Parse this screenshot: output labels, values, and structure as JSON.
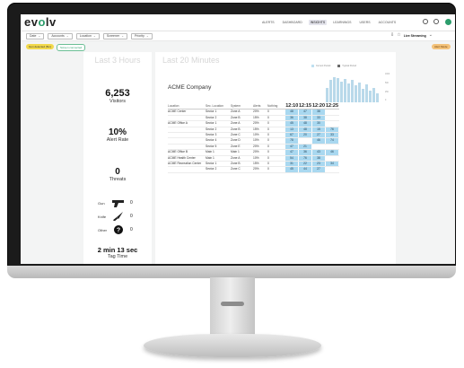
{
  "app": {
    "logo_prefix": "ev",
    "logo_o": "o",
    "logo_suffix": "lv"
  },
  "nav": [
    "ALERTS",
    "DASHBOARD",
    "INSIGHTS",
    "LEARNINGS",
    "USERS",
    "ACCOUNTS"
  ],
  "nav_active_index": 2,
  "header_icons": [
    "help-icon",
    "settings-icon",
    "profile-icon"
  ],
  "filters": [
    "Date",
    "Accounts",
    "Location",
    "Screener",
    "Priority"
  ],
  "live": {
    "label": "Live Streaming",
    "icons": [
      "share-icon",
      "star-icon",
      "more-icon"
    ]
  },
  "chips": {
    "yellow": "Gun detected (5m)",
    "outline": "Screen connected",
    "orange": "Alert Mode"
  },
  "left_panel": {
    "title": "Last 3 Hours",
    "visitors_value": "6,253",
    "visitors_label": "Visitors",
    "alert_rate_value": "10%",
    "alert_rate_label": "Alert Rate",
    "threats_value": "0",
    "threats_label": "Threats",
    "weapons": [
      {
        "label": "Gun",
        "icon": "gun-icon",
        "count": "0"
      },
      {
        "label": "Knife",
        "icon": "knife-icon",
        "count": "0"
      },
      {
        "label": "Other",
        "icon": "other-icon",
        "count": "0"
      }
    ],
    "tag_time_value": "2 min 13 sec",
    "tag_time_label": "Tag Time"
  },
  "right_panel": {
    "title": "Last 20 Minutes",
    "company": "ACME Company",
    "legend": [
      "Current Period",
      "Typical Period"
    ],
    "legend_colors": [
      "#bfe0f0",
      "#6a6a6a"
    ],
    "y_ticks": [
      "1000",
      "500",
      "250",
      "0"
    ],
    "columns": [
      "Location",
      "Sec. Location",
      "System",
      "Alerts",
      "Nothing"
    ],
    "times": [
      "12:10",
      "12:15",
      "12:20",
      "12:25"
    ],
    "rows": [
      {
        "location": "ACME Center",
        "sec": "Sector 1",
        "system": "Zone A",
        "alerts": "20%",
        "nothing": "0",
        "vals": [
          "48",
          "47",
          "38",
          ""
        ]
      },
      {
        "location": "",
        "sec": "Sector 2",
        "system": "Zone B",
        "alerts": "15%",
        "nothing": "0",
        "vals": [
          "36",
          "38",
          "33",
          ""
        ]
      },
      {
        "location": "ACME Office A",
        "sec": "Sector 1",
        "system": "Zone A",
        "alerts": "20%",
        "nothing": "0",
        "vals": [
          "45",
          "48",
          "30",
          ""
        ]
      },
      {
        "location": "",
        "sec": "Sector 2",
        "system": "Zone B",
        "alerts": "15%",
        "nothing": "0",
        "vals": [
          "13",
          "48",
          "15",
          "76"
        ]
      },
      {
        "location": "",
        "sec": "Sector 3",
        "system": "Zone C",
        "alerts": "10%",
        "nothing": "0",
        "vals": [
          "67",
          "20",
          "27",
          "33"
        ]
      },
      {
        "location": "",
        "sec": "Sector 4",
        "system": "Zone D",
        "alerts": "10%",
        "nothing": "0",
        "vals": [
          "78",
          "",
          "46",
          "74"
        ]
      },
      {
        "location": "",
        "sec": "Sector 5",
        "system": "Zone E",
        "alerts": "20%",
        "nothing": "0",
        "vals": [
          "47",
          "21",
          "",
          ""
        ]
      },
      {
        "location": "ACME Office B",
        "sec": "Main 1",
        "system": "Main 1",
        "alerts": "20%",
        "nothing": "0",
        "vals": [
          "47",
          "36",
          "43",
          "46"
        ]
      },
      {
        "location": "ACME Health Center",
        "sec": "Main 1",
        "system": "Zone A",
        "alerts": "10%",
        "nothing": "0",
        "vals": [
          "54",
          "76",
          "38",
          ""
        ]
      },
      {
        "location": "ACME Recreation Center",
        "sec": "Sector 1",
        "system": "Zone B",
        "alerts": "15%",
        "nothing": "0",
        "vals": [
          "31",
          "22",
          "23",
          "34"
        ]
      },
      {
        "location": "",
        "sec": "Sector 2",
        "system": "Zone C",
        "alerts": "20%",
        "nothing": "0",
        "vals": [
          "45",
          "44",
          "27",
          ""
        ]
      }
    ],
    "histogram_values": [
      0.55,
      0.82,
      0.95,
      0.9,
      0.78,
      0.88,
      0.7,
      0.84,
      0.62,
      0.75,
      0.5,
      0.66,
      0.45,
      0.55,
      0.35
    ]
  }
}
